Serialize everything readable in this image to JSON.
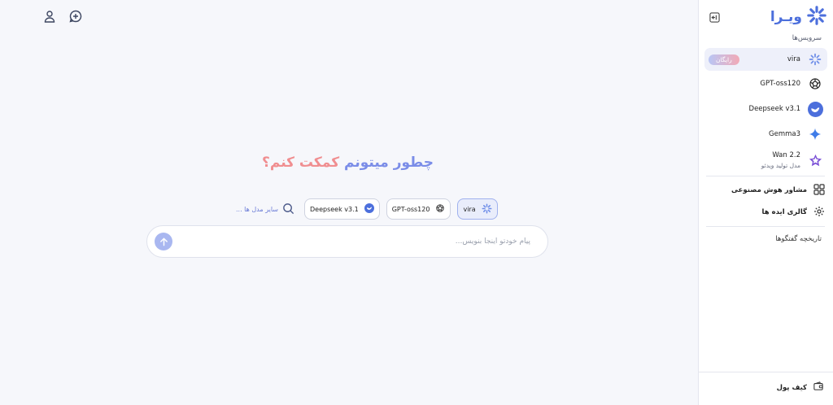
{
  "brand": {
    "name": "ویـرا"
  },
  "sidebar": {
    "section_label": "سرویس‌ها",
    "services": [
      {
        "label": "vira",
        "badge": "رایگان",
        "active": true
      },
      {
        "label": "GPT-oss120"
      },
      {
        "label": "Deepseek v3.1"
      },
      {
        "label": "Gemma3"
      },
      {
        "label": "Wan 2.2",
        "sub": "مدل تولید ویدئو"
      }
    ],
    "menu": [
      {
        "label": "مشاور هوش مصنوعی"
      },
      {
        "label": "گالری ایده ها"
      }
    ],
    "history_label": "تاریخچه گفتگوها",
    "wallet_label": "کیف پول"
  },
  "main": {
    "headline_part1": "چطور میتونم ",
    "headline_part2": "کمکت کنم؟",
    "chips": [
      {
        "label": "vira"
      },
      {
        "label": "GPT-oss120"
      },
      {
        "label": "Deepseek v3.1"
      }
    ],
    "more_models": "سایر مدل ها ...",
    "input_placeholder": "پیام خودتو اینجا بنویس..."
  },
  "colors": {
    "accent": "#4c6fdc",
    "headline_blue": "#7b8de8",
    "headline_pink": "#f08e90",
    "send_button": "#a9b7f0"
  }
}
